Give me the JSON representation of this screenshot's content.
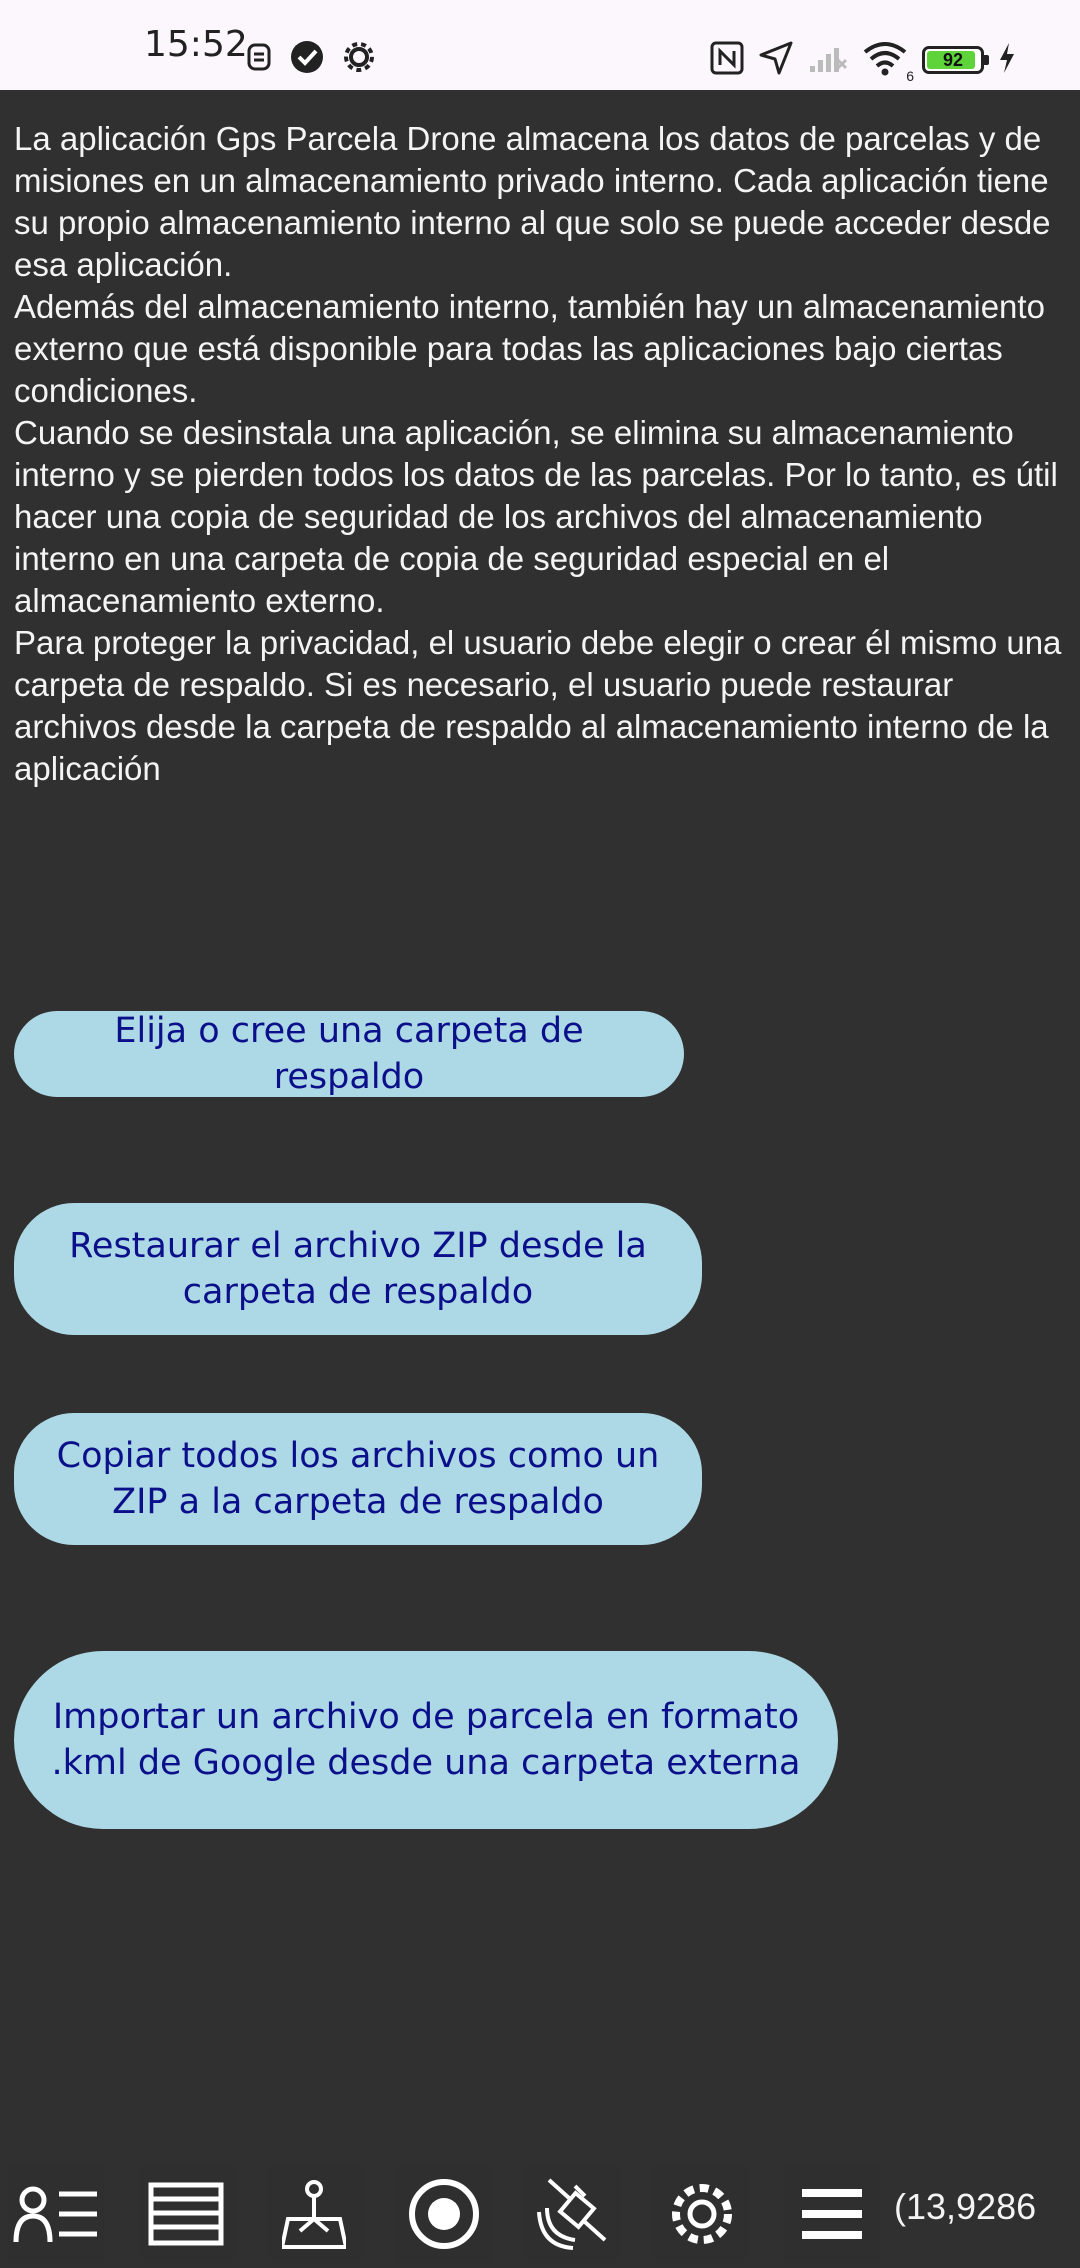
{
  "status_bar": {
    "time": "15:52",
    "battery_level": "92",
    "network_label": "6",
    "left_icons": [
      "sim-icon",
      "check-circle-icon",
      "settings-icon"
    ],
    "right_icons": [
      "nfc-icon",
      "location-arrow-icon",
      "signal-off-icon",
      "wifi-icon",
      "battery-icon",
      "charging-icon"
    ]
  },
  "info": {
    "paragraphs": [
      "La aplicación Gps Parcela Drone almacena los datos de parcelas y de misiones en un almacenamiento privado interno. Cada aplicación tiene su propio almacenamiento interno al que solo se puede acceder desde esa aplicación.",
      "Además del almacenamiento interno, también hay un almacenamiento externo que está disponible para todas las aplicaciones bajo ciertas condiciones.",
      "Cuando se desinstala una aplicación, se elimina su almacenamiento interno y se pierden todos los datos de las parcelas. Por lo tanto, es útil hacer una copia de seguridad de los archivos del almacenamiento interno en una carpeta de copia de seguridad especial en el almacenamiento externo.",
      "Para proteger la privacidad, el usuario debe elegir o crear él mismo una carpeta de respaldo. Si es necesario, el usuario puede restaurar archivos desde la carpeta de respaldo al almacenamiento interno de la aplicación"
    ]
  },
  "buttons": {
    "choose_folder": "Elija o cree una carpeta de respaldo",
    "restore_zip": "Restaurar el archivo ZIP desde la carpeta de respaldo",
    "copy_zip": "Copiar todos los archivos como un ZIP a la carpeta de respaldo",
    "import_kml": "Importar un archivo de parcela en formato .kml de Google desde una carpeta externa"
  },
  "colors": {
    "background": "#303030",
    "button_bg": "#add8e6",
    "button_text": "#0b0f8a"
  },
  "bottom_nav": {
    "items": [
      "user-list-icon",
      "layers-icon",
      "survey-icon",
      "record-icon",
      "satellite-icon",
      "settings-icon",
      "menu-icon"
    ],
    "coordinates": "(13,9286"
  }
}
